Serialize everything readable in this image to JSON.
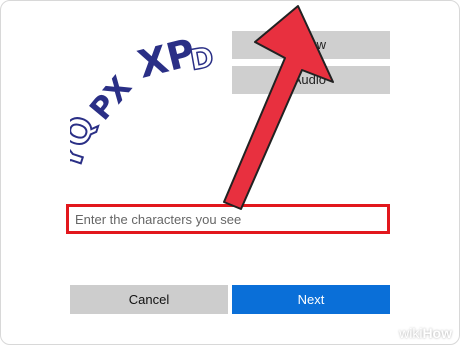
{
  "captcha": {
    "text": "YQPXPD"
  },
  "side_buttons": {
    "new_label": "New",
    "audio_label": "Audio"
  },
  "input": {
    "placeholder": "Enter the characters you see"
  },
  "buttons": {
    "cancel_label": "Cancel",
    "next_label": "Next"
  },
  "watermark": {
    "wiki": "wiki",
    "how": "How"
  },
  "colors": {
    "highlight_red": "#e2171d",
    "arrow_red": "#e8303f",
    "next_blue": "#0a6fd8",
    "button_gray": "#cdcdcd",
    "captcha_blue": "#2a2f86"
  },
  "icons": {
    "pointer": "red-arrow-icon"
  }
}
